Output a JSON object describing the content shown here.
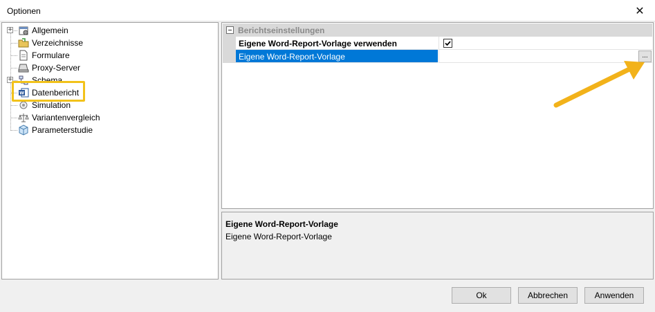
{
  "window": {
    "title": "Optionen"
  },
  "tree": {
    "items": [
      {
        "label": "Allgemein",
        "icon": "general-settings-icon",
        "expandable": true
      },
      {
        "label": "Verzeichnisse",
        "icon": "folder-icon",
        "expandable": false
      },
      {
        "label": "Formulare",
        "icon": "form-document-icon",
        "expandable": false
      },
      {
        "label": "Proxy-Server",
        "icon": "server-icon",
        "expandable": false
      },
      {
        "label": "Schema",
        "icon": "schema-icon",
        "expandable": true
      },
      {
        "label": "Datenbericht",
        "icon": "word-document-icon",
        "expandable": false,
        "highlighted": true
      },
      {
        "label": "Simulation",
        "icon": "simulation-icon",
        "expandable": false
      },
      {
        "label": "Variantenvergleich",
        "icon": "balance-scale-icon",
        "expandable": false
      },
      {
        "label": "Parameterstudie",
        "icon": "cube-icon",
        "expandable": false
      }
    ]
  },
  "property_grid": {
    "category": "Berichtseinstellungen",
    "rows": [
      {
        "name": "Eigene Word-Report-Vorlage verwenden",
        "checked": true
      },
      {
        "name": "Eigene Word-Report-Vorlage",
        "value": "",
        "button_label": "..."
      }
    ]
  },
  "description": {
    "title": "Eigene Word-Report-Vorlage",
    "text": "Eigene Word-Report-Vorlage"
  },
  "buttons": {
    "ok": "Ok",
    "cancel": "Abbrechen",
    "apply": "Anwenden"
  },
  "colors": {
    "selection": "#0078d7",
    "highlight": "#f2c21a",
    "category_bg": "#d9d9d9"
  }
}
